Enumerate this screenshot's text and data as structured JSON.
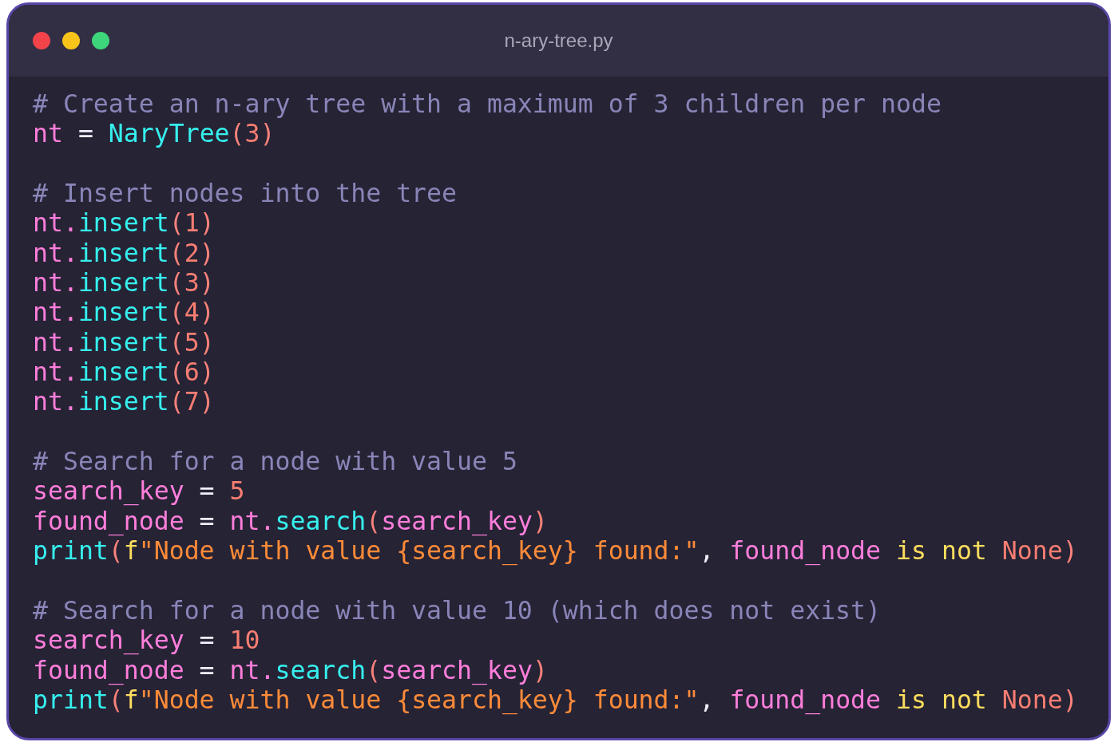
{
  "window": {
    "title": "n-ary-tree.py"
  },
  "lines": [
    {
      "kind": "code",
      "tokens": [
        {
          "text": "# Create an n-ary tree with a maximum of 3 children per node",
          "kind": "comment"
        }
      ]
    },
    {
      "kind": "code",
      "tokens": [
        {
          "text": "nt",
          "kind": "variable"
        },
        {
          "text": " = ",
          "kind": "operator"
        },
        {
          "text": "NaryTree",
          "kind": "function"
        },
        {
          "text": "(",
          "kind": "punct"
        },
        {
          "text": "3",
          "kind": "number"
        },
        {
          "text": ")",
          "kind": "punct"
        }
      ]
    },
    {
      "kind": "blank"
    },
    {
      "kind": "code",
      "tokens": [
        {
          "text": "# Insert nodes into the tree",
          "kind": "comment"
        }
      ]
    },
    {
      "kind": "code",
      "tokens": [
        {
          "text": "nt.",
          "kind": "variable"
        },
        {
          "text": "insert",
          "kind": "function"
        },
        {
          "text": "(",
          "kind": "punct"
        },
        {
          "text": "1",
          "kind": "number"
        },
        {
          "text": ")",
          "kind": "punct"
        }
      ]
    },
    {
      "kind": "code",
      "tokens": [
        {
          "text": "nt.",
          "kind": "variable"
        },
        {
          "text": "insert",
          "kind": "function"
        },
        {
          "text": "(",
          "kind": "punct"
        },
        {
          "text": "2",
          "kind": "number"
        },
        {
          "text": ")",
          "kind": "punct"
        }
      ]
    },
    {
      "kind": "code",
      "tokens": [
        {
          "text": "nt.",
          "kind": "variable"
        },
        {
          "text": "insert",
          "kind": "function"
        },
        {
          "text": "(",
          "kind": "punct"
        },
        {
          "text": "3",
          "kind": "number"
        },
        {
          "text": ")",
          "kind": "punct"
        }
      ]
    },
    {
      "kind": "code",
      "tokens": [
        {
          "text": "nt.",
          "kind": "variable"
        },
        {
          "text": "insert",
          "kind": "function"
        },
        {
          "text": "(",
          "kind": "punct"
        },
        {
          "text": "4",
          "kind": "number"
        },
        {
          "text": ")",
          "kind": "punct"
        }
      ]
    },
    {
      "kind": "code",
      "tokens": [
        {
          "text": "nt.",
          "kind": "variable"
        },
        {
          "text": "insert",
          "kind": "function"
        },
        {
          "text": "(",
          "kind": "punct"
        },
        {
          "text": "5",
          "kind": "number"
        },
        {
          "text": ")",
          "kind": "punct"
        }
      ]
    },
    {
      "kind": "code",
      "tokens": [
        {
          "text": "nt.",
          "kind": "variable"
        },
        {
          "text": "insert",
          "kind": "function"
        },
        {
          "text": "(",
          "kind": "punct"
        },
        {
          "text": "6",
          "kind": "number"
        },
        {
          "text": ")",
          "kind": "punct"
        }
      ]
    },
    {
      "kind": "code",
      "tokens": [
        {
          "text": "nt.",
          "kind": "variable"
        },
        {
          "text": "insert",
          "kind": "function"
        },
        {
          "text": "(",
          "kind": "punct"
        },
        {
          "text": "7",
          "kind": "number"
        },
        {
          "text": ")",
          "kind": "punct"
        }
      ]
    },
    {
      "kind": "blank"
    },
    {
      "kind": "code",
      "tokens": [
        {
          "text": "# Search for a node with value 5",
          "kind": "comment"
        }
      ]
    },
    {
      "kind": "code",
      "tokens": [
        {
          "text": "search_key",
          "kind": "variable"
        },
        {
          "text": " = ",
          "kind": "operator"
        },
        {
          "text": "5",
          "kind": "number"
        }
      ]
    },
    {
      "kind": "code",
      "tokens": [
        {
          "text": "found_node",
          "kind": "variable"
        },
        {
          "text": " = ",
          "kind": "operator"
        },
        {
          "text": "nt.",
          "kind": "variable"
        },
        {
          "text": "search",
          "kind": "function"
        },
        {
          "text": "(",
          "kind": "punct"
        },
        {
          "text": "search_key",
          "kind": "variable"
        },
        {
          "text": ")",
          "kind": "punct"
        }
      ]
    },
    {
      "kind": "code",
      "tokens": [
        {
          "text": "print",
          "kind": "function"
        },
        {
          "text": "(",
          "kind": "punct"
        },
        {
          "text": "f",
          "kind": "keyword"
        },
        {
          "text": "\"Node with value {search_key} found:\"",
          "kind": "string"
        },
        {
          "text": ", ",
          "kind": "operator"
        },
        {
          "text": "found_node ",
          "kind": "variable"
        },
        {
          "text": "is not",
          "kind": "keyword"
        },
        {
          "text": " None",
          "kind": "constant"
        },
        {
          "text": ")",
          "kind": "punct"
        }
      ]
    },
    {
      "kind": "blank"
    },
    {
      "kind": "code",
      "tokens": [
        {
          "text": "# Search for a node with value 10 (which does not exist)",
          "kind": "comment"
        }
      ]
    },
    {
      "kind": "code",
      "tokens": [
        {
          "text": "search_key",
          "kind": "variable"
        },
        {
          "text": " = ",
          "kind": "operator"
        },
        {
          "text": "10",
          "kind": "number"
        }
      ]
    },
    {
      "kind": "code",
      "tokens": [
        {
          "text": "found_node",
          "kind": "variable"
        },
        {
          "text": " = ",
          "kind": "operator"
        },
        {
          "text": "nt.",
          "kind": "variable"
        },
        {
          "text": "search",
          "kind": "function"
        },
        {
          "text": "(",
          "kind": "punct"
        },
        {
          "text": "search_key",
          "kind": "variable"
        },
        {
          "text": ")",
          "kind": "punct"
        }
      ]
    },
    {
      "kind": "code",
      "tokens": [
        {
          "text": "print",
          "kind": "function"
        },
        {
          "text": "(",
          "kind": "punct"
        },
        {
          "text": "f",
          "kind": "keyword"
        },
        {
          "text": "\"Node with value {search_key} found:\"",
          "kind": "string"
        },
        {
          "text": ", ",
          "kind": "operator"
        },
        {
          "text": "found_node ",
          "kind": "variable"
        },
        {
          "text": "is not",
          "kind": "keyword"
        },
        {
          "text": " None",
          "kind": "constant"
        },
        {
          "text": ")",
          "kind": "punct"
        }
      ]
    }
  ]
}
